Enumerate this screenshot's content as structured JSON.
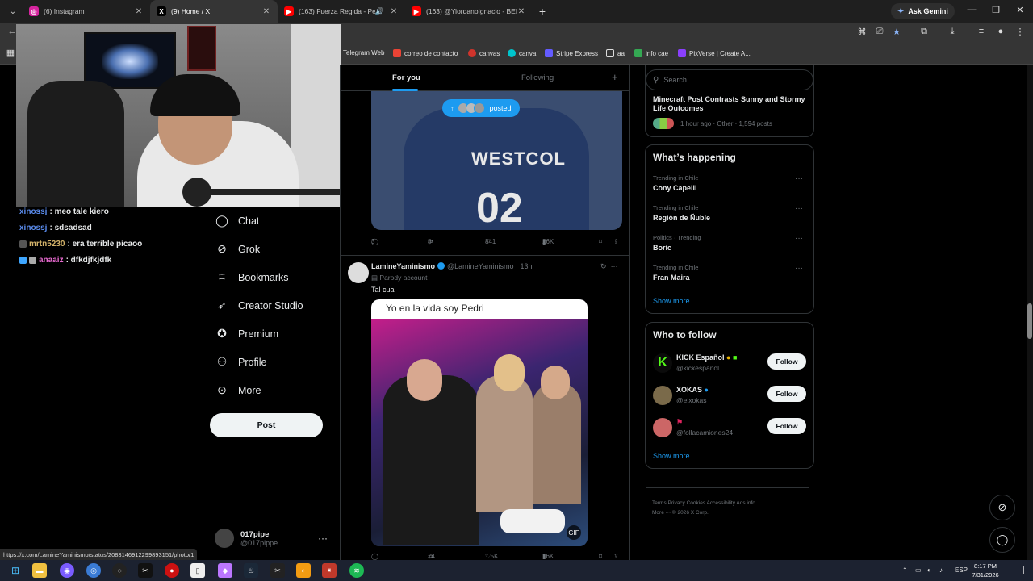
{
  "browser": {
    "tabs": [
      {
        "title": "(6) Instagram",
        "icon": "instagram-icon",
        "color": "#d6249f"
      },
      {
        "title": "(9) Home / X",
        "icon": "x-icon",
        "color": "#000000",
        "active": true
      },
      {
        "title": "(163) Fuerza Regida - Pero",
        "icon": "youtube-icon",
        "color": "#ff0000",
        "audio": true
      },
      {
        "title": "(163) @YiordanoIgnacio - BER",
        "icon": "youtube-icon",
        "color": "#ff0000"
      }
    ],
    "ask_gemini": "Ask Gemini",
    "bookmarks": [
      {
        "label": "Telegram Web",
        "color": "#2aa3df"
      },
      {
        "label": "correo de contacto",
        "color": "#ea4335"
      },
      {
        "label": "canvas",
        "color": "#d0342c"
      },
      {
        "label": "canva",
        "color": "#00c4cc"
      },
      {
        "label": "Stripe Express",
        "color": "#635bff"
      },
      {
        "label": "aa",
        "color": "#e8e8e8"
      },
      {
        "label": "info cae",
        "color": "#34a853"
      },
      {
        "label": "PixVerse | Create A...",
        "color": "#8a3ffc"
      }
    ],
    "status_url": "https://x.com/LamineYaminismo/status/2083146912299893151/photo/1"
  },
  "stream_chat": [
    {
      "user": "xinossj",
      "msg": ": meo tale kiero",
      "color": "#5b8def"
    },
    {
      "user": "xinossj",
      "msg": ": sdsadsad",
      "color": "#5b8def"
    },
    {
      "user": "mrtn5230",
      "msg": ": era terrible picaoo",
      "color": "#d4b36a"
    },
    {
      "user": "anaaiz",
      "msg": ": dfkdjfkjdfk",
      "color": "#e86ad0"
    }
  ],
  "nav": {
    "items": [
      {
        "label": "Chat",
        "icon": "chat-icon",
        "glyph": "◯"
      },
      {
        "label": "Grok",
        "icon": "grok-icon",
        "glyph": "⊘"
      },
      {
        "label": "Bookmarks",
        "icon": "bookmark-icon",
        "glyph": "⌑"
      },
      {
        "label": "Creator Studio",
        "icon": "rocket-icon",
        "glyph": "➶"
      },
      {
        "label": "Premium",
        "icon": "premium-icon",
        "glyph": "✪"
      },
      {
        "label": "Profile",
        "icon": "profile-icon",
        "glyph": "⚇"
      },
      {
        "label": "More",
        "icon": "more-icon",
        "glyph": "⊙"
      }
    ],
    "post_label": "Post",
    "account_name": "017pipe",
    "account_handle": "@017pippe"
  },
  "feed": {
    "tab_for_you": "For you",
    "tab_following": "Following",
    "posted_pill": "posted",
    "tweet1": {
      "shirt_text": "WESTCOL",
      "shirt_number": "02",
      "replies": "3",
      "reposts": "8",
      "likes": "841",
      "views": "26K"
    },
    "tweet2": {
      "name": "LamineYaminismo",
      "handle": "@LamineYaminismo",
      "time": "13h",
      "parody": "Parody account",
      "text": "Tal cual",
      "caption": "Yo en la vida soy Pedri",
      "reposts": "74",
      "likes": "1.5K",
      "views": "16K",
      "gif_label": "GIF"
    }
  },
  "right": {
    "search_placeholder": "Search",
    "news": {
      "title": "Minecraft Post Contrasts Sunny and Stormy Life Outcomes",
      "meta": "1 hour ago · Other · 1,594 posts"
    },
    "happening_title": "What’s happening",
    "trends": [
      {
        "context": "Trending in Chile",
        "name": "Cony Capelli"
      },
      {
        "context": "Trending in Chile",
        "name": "Región de Ñuble"
      },
      {
        "context": "Politics · Trending",
        "name": "Boric"
      },
      {
        "context": "Trending in Chile",
        "name": "Fran Maira"
      }
    ],
    "show_more": "Show more",
    "who_title": "Who to follow",
    "who": [
      {
        "name": "KICK Español",
        "handle": "@kickespanol",
        "avatar_color": "#53fc18"
      },
      {
        "name": "XOKAS",
        "handle": "@elxokas",
        "avatar_color": "#7a6a4a"
      },
      {
        "name": "",
        "handle": "@follacamiones24",
        "avatar_color": "#c66"
      }
    ],
    "follow_label": "Follow",
    "footer_line1": "Terms    Privacy    Cookies    Accessibility    Ads info",
    "footer_line2": "More ···    © 2026 X Corp."
  },
  "taskbar": {
    "lang": "ESP",
    "time": "8:17 PM",
    "date": "7/31/2026"
  }
}
